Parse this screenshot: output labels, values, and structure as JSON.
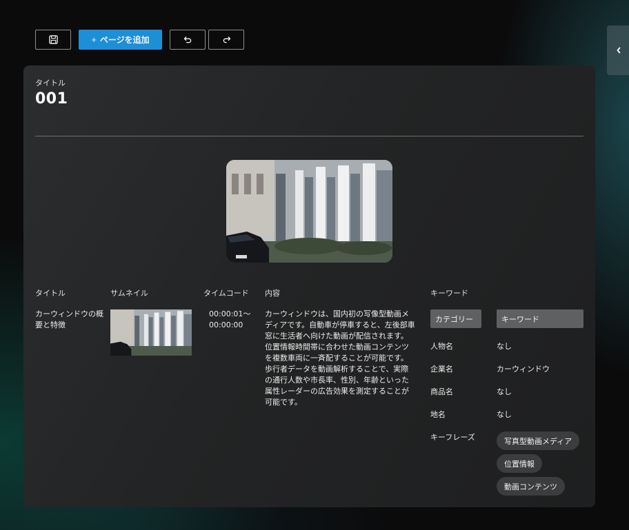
{
  "toolbar": {
    "save_icon": "floppy-disk-icon",
    "add_page_plus": "+",
    "add_page_label": "ページを追加",
    "undo_icon": "undo-icon",
    "redo_icon": "redo-icon",
    "accent_color": "#1d8fd6"
  },
  "side_panel": {
    "toggle_icon": "chevron-left-icon"
  },
  "page": {
    "title_label": "タイトル",
    "title_value": "001"
  },
  "table": {
    "headers": {
      "title": "タイトル",
      "thumbnail": "サムネイル",
      "timecode": "タイムコード",
      "content": "内容",
      "keywords": "キーワード"
    },
    "row": {
      "title": "カーウィンドウの概要と特徴",
      "timecode_start": "00:00:01〜",
      "timecode_end": "00:00:00",
      "content": "カーウィンドウは、国内初の写像型動画メディアです。自動車が停車すると、左後部車窓に生活者へ向けた動画が配信されます。位置情報時間帯に合わせた動画コンテンツを複数車両に一斉配することが可能です。歩行者データを動画解析することで、実際の通行人数や市長率、性別、年齢といった属性レーダーの広告効果を測定することが可能です。"
    }
  },
  "keywords": {
    "category_header": "カテゴリー",
    "keyword_header": "キーワード",
    "person_label": "人物名",
    "person_value": "なし",
    "company_label": "企業名",
    "company_value": "カーウィンドウ",
    "product_label": "商品名",
    "product_value": "なし",
    "place_label": "地名",
    "place_value": "なし",
    "phrase_label": "キーフレーズ",
    "phrases": [
      "写真型動画メディア",
      "位置情報",
      "動画コンテンツ"
    ]
  }
}
